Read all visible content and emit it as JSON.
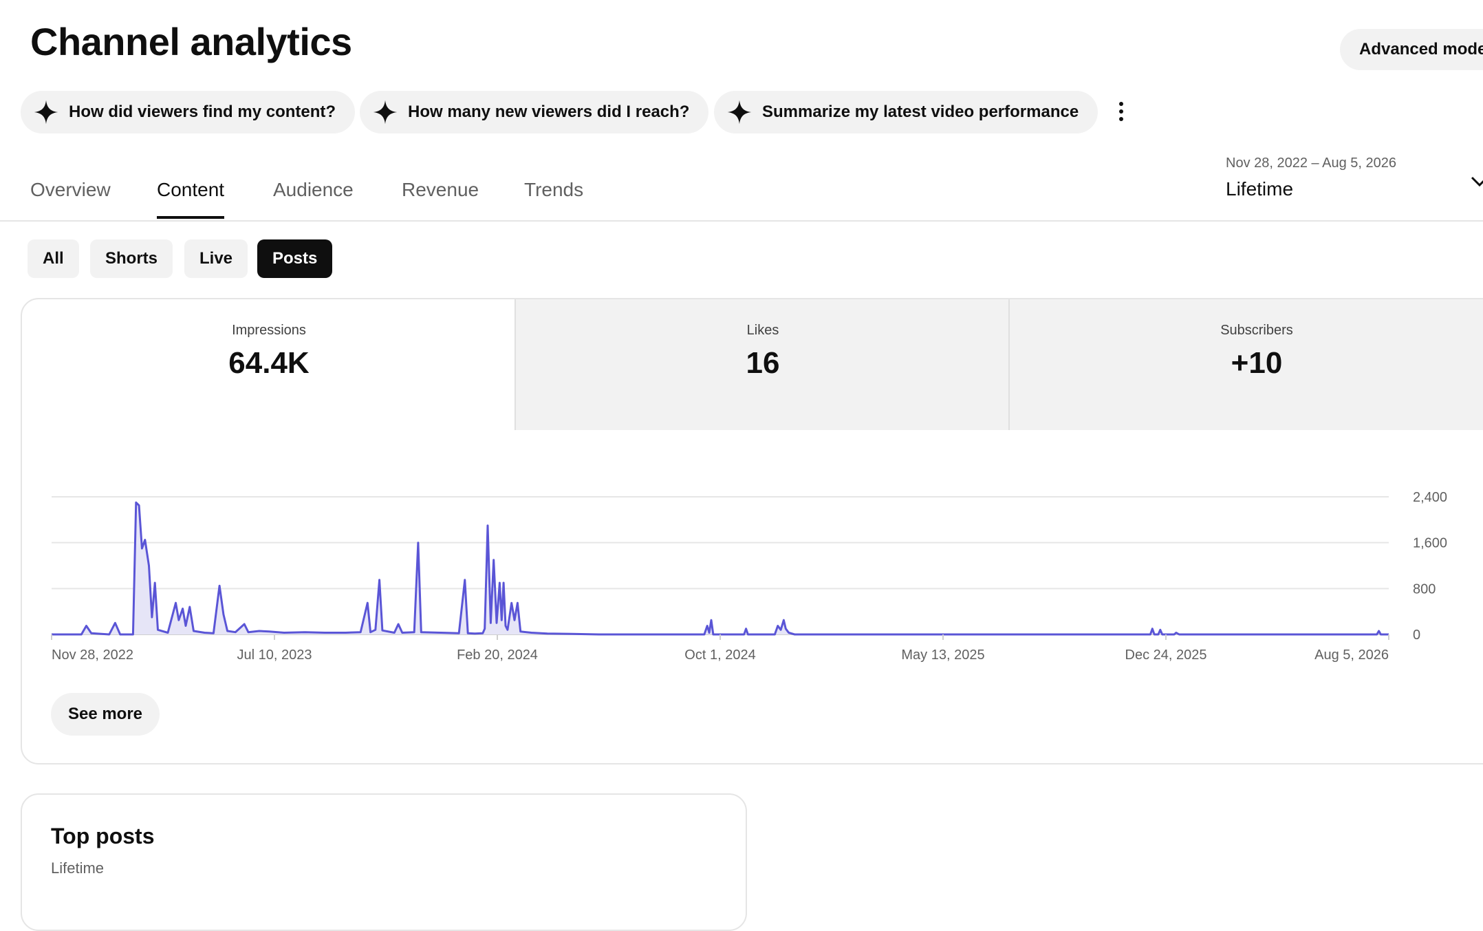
{
  "header": {
    "title": "Channel analytics",
    "advanced_mode_label": "Advanced mode"
  },
  "suggestions": [
    {
      "label": "How did viewers find my content?"
    },
    {
      "label": "How many new viewers did I reach?"
    },
    {
      "label": "Summarize my latest video performance"
    }
  ],
  "tabs": [
    {
      "label": "Overview"
    },
    {
      "label": "Content",
      "active": true
    },
    {
      "label": "Audience"
    },
    {
      "label": "Revenue"
    },
    {
      "label": "Trends"
    }
  ],
  "date_range": {
    "range": "Nov 28, 2022 – Aug 5, 2026",
    "preset": "Lifetime"
  },
  "filters": [
    {
      "label": "All"
    },
    {
      "label": "Shorts"
    },
    {
      "label": "Live"
    },
    {
      "label": "Posts",
      "active": true
    }
  ],
  "metrics": [
    {
      "label": "Impressions",
      "value": "64.4K",
      "selected": true
    },
    {
      "label": "Likes",
      "value": "16"
    },
    {
      "label": "Subscribers",
      "value": "+10"
    }
  ],
  "see_more_label": "See more",
  "top_posts": {
    "title": "Top posts",
    "subtitle": "Lifetime"
  },
  "colors": {
    "series": "#5a55d6",
    "series_fill": "#e6e5f7"
  },
  "chart_data": {
    "type": "area",
    "xlabel": "",
    "ylabel": "",
    "x_start": "2022-11-28",
    "x_end": "2026-08-05",
    "x_ticks": [
      "Nov 28, 2022",
      "Jul 10, 2023",
      "Feb 20, 2024",
      "Oct 1, 2024",
      "May 13, 2025",
      "Dec 24, 2025",
      "Aug 5, 2026"
    ],
    "y_ticks": [
      "0",
      "800",
      "1,600",
      "2,400"
    ],
    "ylim": [
      0,
      2400
    ],
    "grid": true,
    "series": [
      {
        "points": [
          [
            "2022-11-28",
            0
          ],
          [
            "2022-12-28",
            0
          ],
          [
            "2023-01-02",
            150
          ],
          [
            "2023-01-07",
            20
          ],
          [
            "2023-01-25",
            0
          ],
          [
            "2023-01-31",
            200
          ],
          [
            "2023-02-05",
            0
          ],
          [
            "2023-02-18",
            0
          ],
          [
            "2023-02-21",
            2300
          ],
          [
            "2023-02-24",
            2250
          ],
          [
            "2023-02-27",
            1500
          ],
          [
            "2023-03-02",
            1650
          ],
          [
            "2023-03-06",
            1200
          ],
          [
            "2023-03-09",
            300
          ],
          [
            "2023-03-12",
            900
          ],
          [
            "2023-03-15",
            80
          ],
          [
            "2023-03-25",
            30
          ],
          [
            "2023-04-02",
            550
          ],
          [
            "2023-04-05",
            250
          ],
          [
            "2023-04-09",
            450
          ],
          [
            "2023-04-12",
            150
          ],
          [
            "2023-04-16",
            480
          ],
          [
            "2023-04-20",
            60
          ],
          [
            "2023-05-01",
            30
          ],
          [
            "2023-05-10",
            20
          ],
          [
            "2023-05-16",
            850
          ],
          [
            "2023-05-20",
            350
          ],
          [
            "2023-05-24",
            60
          ],
          [
            "2023-06-01",
            40
          ],
          [
            "2023-06-10",
            180
          ],
          [
            "2023-06-14",
            40
          ],
          [
            "2023-06-25",
            60
          ],
          [
            "2023-07-05",
            50
          ],
          [
            "2023-07-20",
            30
          ],
          [
            "2023-08-10",
            40
          ],
          [
            "2023-08-30",
            30
          ],
          [
            "2023-09-20",
            30
          ],
          [
            "2023-10-05",
            40
          ],
          [
            "2023-10-12",
            550
          ],
          [
            "2023-10-15",
            40
          ],
          [
            "2023-10-20",
            80
          ],
          [
            "2023-10-24",
            950
          ],
          [
            "2023-10-27",
            70
          ],
          [
            "2023-11-08",
            30
          ],
          [
            "2023-11-12",
            180
          ],
          [
            "2023-11-16",
            30
          ],
          [
            "2023-11-28",
            40
          ],
          [
            "2023-12-02",
            1600
          ],
          [
            "2023-12-05",
            40
          ],
          [
            "2023-12-25",
            30
          ],
          [
            "2024-01-12",
            20
          ],
          [
            "2024-01-18",
            950
          ],
          [
            "2024-01-21",
            20
          ],
          [
            "2024-01-28",
            15
          ],
          [
            "2024-02-05",
            20
          ],
          [
            "2024-02-07",
            100
          ],
          [
            "2024-02-10",
            1900
          ],
          [
            "2024-02-13",
            200
          ],
          [
            "2024-02-16",
            1300
          ],
          [
            "2024-02-19",
            200
          ],
          [
            "2024-02-22",
            900
          ],
          [
            "2024-02-24",
            250
          ],
          [
            "2024-02-26",
            900
          ],
          [
            "2024-02-28",
            150
          ],
          [
            "2024-03-01",
            80
          ],
          [
            "2024-03-05",
            550
          ],
          [
            "2024-03-08",
            250
          ],
          [
            "2024-03-11",
            550
          ],
          [
            "2024-03-14",
            50
          ],
          [
            "2024-03-25",
            30
          ],
          [
            "2024-04-10",
            15
          ],
          [
            "2024-05-05",
            10
          ],
          [
            "2024-06-01",
            0
          ],
          [
            "2024-09-15",
            0
          ],
          [
            "2024-09-18",
            150
          ],
          [
            "2024-09-20",
            30
          ],
          [
            "2024-09-22",
            250
          ],
          [
            "2024-09-24",
            0
          ],
          [
            "2024-10-25",
            0
          ],
          [
            "2024-10-27",
            100
          ],
          [
            "2024-10-29",
            0
          ],
          [
            "2024-11-25",
            0
          ],
          [
            "2024-11-28",
            150
          ],
          [
            "2024-12-01",
            80
          ],
          [
            "2024-12-04",
            250
          ],
          [
            "2024-12-06",
            100
          ],
          [
            "2024-12-09",
            30
          ],
          [
            "2024-12-15",
            0
          ],
          [
            "2025-12-08",
            0
          ],
          [
            "2025-12-10",
            100
          ],
          [
            "2025-12-12",
            0
          ],
          [
            "2025-12-16",
            0
          ],
          [
            "2025-12-18",
            80
          ],
          [
            "2025-12-20",
            0
          ],
          [
            "2026-01-01",
            0
          ],
          [
            "2026-01-03",
            30
          ],
          [
            "2026-01-06",
            0
          ],
          [
            "2026-07-24",
            0
          ],
          [
            "2026-07-26",
            60
          ],
          [
            "2026-07-28",
            0
          ],
          [
            "2026-08-05",
            0
          ]
        ]
      }
    ]
  }
}
